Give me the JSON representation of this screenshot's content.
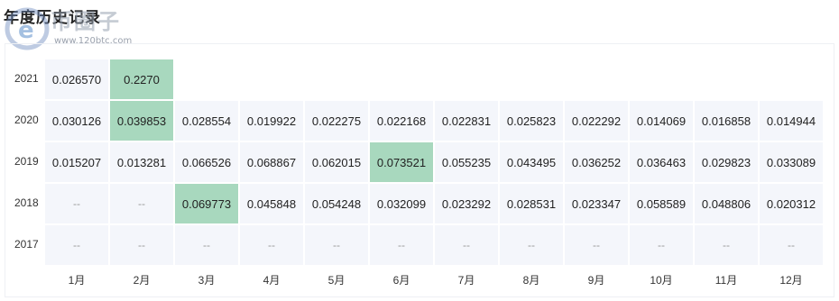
{
  "title": "年度历史记录",
  "watermark": {
    "logo_text": "币圈子",
    "url": "www.120btc.com"
  },
  "empty_marker": "--",
  "highlight_color": "#a8d8be",
  "cell_bg_color": "#f4f6fb",
  "months": [
    "1月",
    "2月",
    "3月",
    "4月",
    "5月",
    "6月",
    "7月",
    "8月",
    "9月",
    "10月",
    "11月",
    "12月"
  ],
  "rows": [
    {
      "year": "2021",
      "highlight": 1,
      "values": [
        "0.026570",
        "0.2270",
        null,
        null,
        null,
        null,
        null,
        null,
        null,
        null,
        null,
        null
      ]
    },
    {
      "year": "2020",
      "highlight": 1,
      "values": [
        "0.030126",
        "0.039853",
        "0.028554",
        "0.019922",
        "0.022275",
        "0.022168",
        "0.022831",
        "0.025823",
        "0.022292",
        "0.014069",
        "0.016858",
        "0.014944"
      ]
    },
    {
      "year": "2019",
      "highlight": 5,
      "values": [
        "0.015207",
        "0.013281",
        "0.066526",
        "0.068867",
        "0.062015",
        "0.073521",
        "0.055235",
        "0.043495",
        "0.036252",
        "0.036463",
        "0.029823",
        "0.033089"
      ]
    },
    {
      "year": "2018",
      "highlight": 2,
      "values": [
        "--",
        "--",
        "0.069773",
        "0.045848",
        "0.054248",
        "0.032099",
        "0.023292",
        "0.028531",
        "0.023347",
        "0.058589",
        "0.048806",
        "0.020312"
      ]
    },
    {
      "year": "2017",
      "highlight": -1,
      "values": [
        "--",
        "--",
        "--",
        "--",
        "--",
        "--",
        "--",
        "--",
        "--",
        "--",
        "--",
        "--"
      ]
    }
  ]
}
